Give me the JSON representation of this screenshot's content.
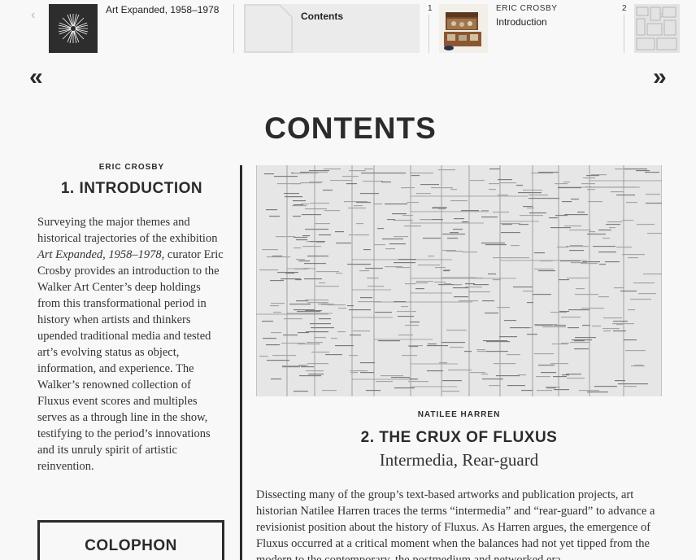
{
  "carousel": {
    "slides": [
      {
        "title": "Art Expanded, 1958–1978",
        "thumb_icon": "starburst-logo-icon"
      },
      {
        "title": "Contents",
        "thumb_icon": "blank-page-icon"
      },
      {
        "number": "1",
        "author": "ERIC CROSBY",
        "title": "Introduction",
        "thumb_icon": "wooden-box-photo-icon"
      },
      {
        "number": "2",
        "thumb_icon": "fluxus-chart-icon"
      }
    ]
  },
  "page_title": "CONTENTS",
  "chapter1": {
    "author": "ERIC CROSBY",
    "title": "1. INTRODUCTION",
    "body_pre": "Surveying the major themes and historical trajectories of the exhibition ",
    "body_em": "Art Expanded, 1958–1978",
    "body_post": ", curator Eric Crosby provides an introduction to the Walker Art Center’s deep holdings from this transformational period in history when artists and thinkers upended traditional media and tested art’s evolving status as object, information, and experience. The Walker’s renowned collection of Fluxus event scores and multiples serves as a through line in the show, testifying to the period’s innovations and its unruly spirit of artistic reinvention."
  },
  "colophon": {
    "label": "COLOPHON"
  },
  "chapter2": {
    "author": "NATILEE HARREN",
    "title": "2. THE CRUX OF FLUXUS",
    "subtitle": "Intermedia, Rear-guard",
    "body": "Dissecting many of the group’s text-based artworks and publication projects, art historian Natilee Harren traces the terms “intermedia” and “rear-guard” to advance a revisionist position about the history of Fluxus. As Harren argues, the emergence of Fluxus occurred at a critical moment when the balances had not yet tipped from the modern to the contemporary, the postmedium and networked era."
  },
  "colors": {
    "text": "#2b2b2b",
    "background": "#f8f8f8",
    "rule": "#2b2b2b"
  }
}
